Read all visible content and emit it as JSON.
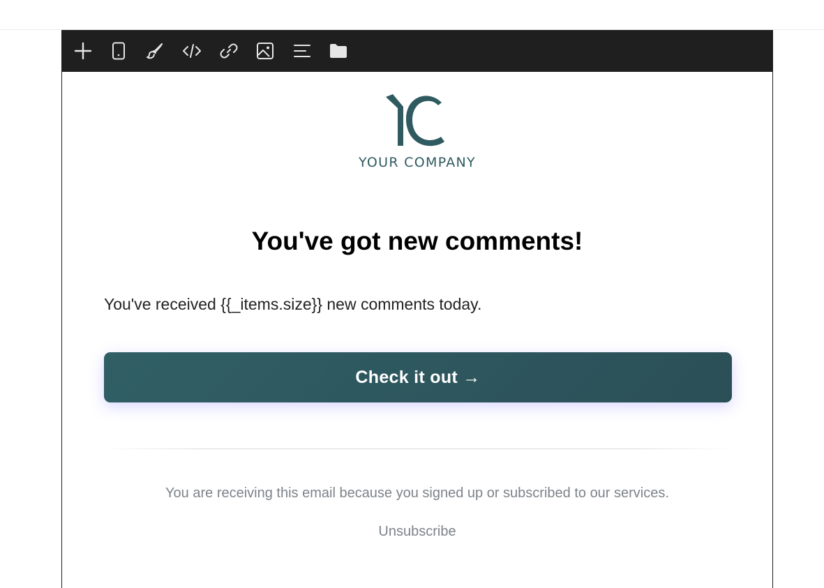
{
  "toolbar": {
    "buttons": [
      {
        "icon": "plus-icon"
      },
      {
        "icon": "mobile-device-icon"
      },
      {
        "icon": "paintbrush-icon"
      },
      {
        "icon": "code-icon"
      },
      {
        "icon": "link-icon"
      },
      {
        "icon": "image-icon"
      },
      {
        "icon": "align-left-icon"
      },
      {
        "icon": "folder-icon"
      }
    ],
    "background": "#1f1f1f",
    "icon_color": "#e6e6e6"
  },
  "email": {
    "logo": {
      "monogram": "YC",
      "company_name": "YOUR COMPANY",
      "color": "#2f5a60"
    },
    "headline": "You've got new comments!",
    "body": "You've received {{_items.size}} new comments today.",
    "cta_label": "Check it out →",
    "cta_color": "#2f5a60",
    "footer_note": "You are receiving this email because you signed up or subscribed to our services.",
    "unsubscribe_label": "Unsubscribe"
  }
}
